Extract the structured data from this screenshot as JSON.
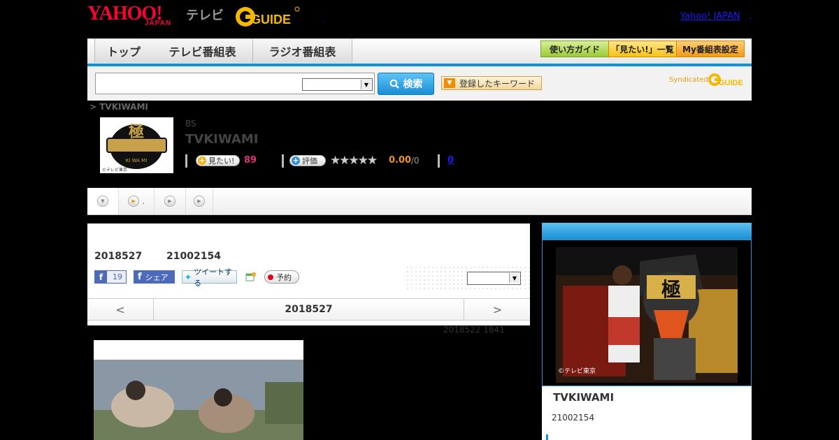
{
  "header": {
    "yahoo": "YAHOO!",
    "japan": "JAPAN",
    "tv": "テレビ",
    "gguide": "GUIDE",
    "yahoo_japan_link": "Yahoo! JAPAN"
  },
  "nav": {
    "tabs": [
      "トップ",
      "テレビ番組表",
      "ラジオ番組表"
    ],
    "buttons": [
      "使い方ガイド",
      "「見たい!」一覧",
      "My番組表設定"
    ]
  },
  "search": {
    "button": "検索",
    "keyword_button": "登録したキーワード",
    "syndicated": "Syndicated"
  },
  "program": {
    "breadcrumb": "> TVKIWAMI",
    "category": "BS",
    "title": "TVKIWAMI",
    "mitai_label": "見たい!",
    "mitai_count": "89",
    "hyoka_label": "評価",
    "stars": "★★★★★",
    "rating": "0.00",
    "rating_max": "/0",
    "comment_count": "0",
    "thumb_caption": "©テレビ東京",
    "thumb_title": "極",
    "thumb_sub": "KI WA MI"
  },
  "tabs": {
    "second_suffix": "."
  },
  "episode": {
    "date": "2018527",
    "id": "21002154",
    "fb_count": "19",
    "fb_share": "シェア",
    "tweet": "ツイートする",
    "reserve": "予約",
    "pager_prev": "<",
    "pager_date": "2018527",
    "pager_next": ">",
    "updated": "2018522  1841"
  },
  "side": {
    "title": "TVKIWAMI",
    "id": "21002154",
    "photo_caption": "©テレビ東京",
    "photo_kanji": "極"
  }
}
